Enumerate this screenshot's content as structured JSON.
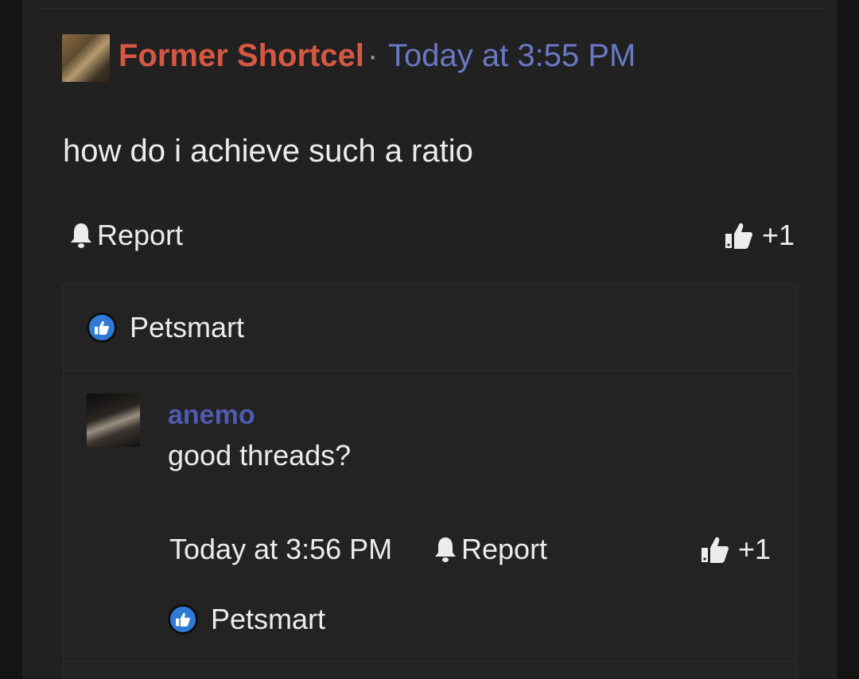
{
  "post": {
    "author": "Former Shortcel",
    "separator": "·",
    "time": "Today at 3:55 PM",
    "body": "how do i achieve such a ratio",
    "report_label": "Report",
    "like_label": "+1",
    "reaction_user": "Petsmart"
  },
  "reply": {
    "author": "anemo",
    "body": "good threads?",
    "time": "Today at 3:56 PM",
    "report_label": "Report",
    "like_label": "+1",
    "reaction_user": "Petsmart"
  },
  "colors": {
    "author": "#d65844",
    "timestamp": "#6b78c4",
    "reply_author": "#4f5bb0",
    "reaction_badge": "#2f7ad6"
  },
  "icons": {
    "report": "bell-icon",
    "like": "thumbs-up-icon",
    "reaction": "thumbs-up-badge-icon"
  }
}
